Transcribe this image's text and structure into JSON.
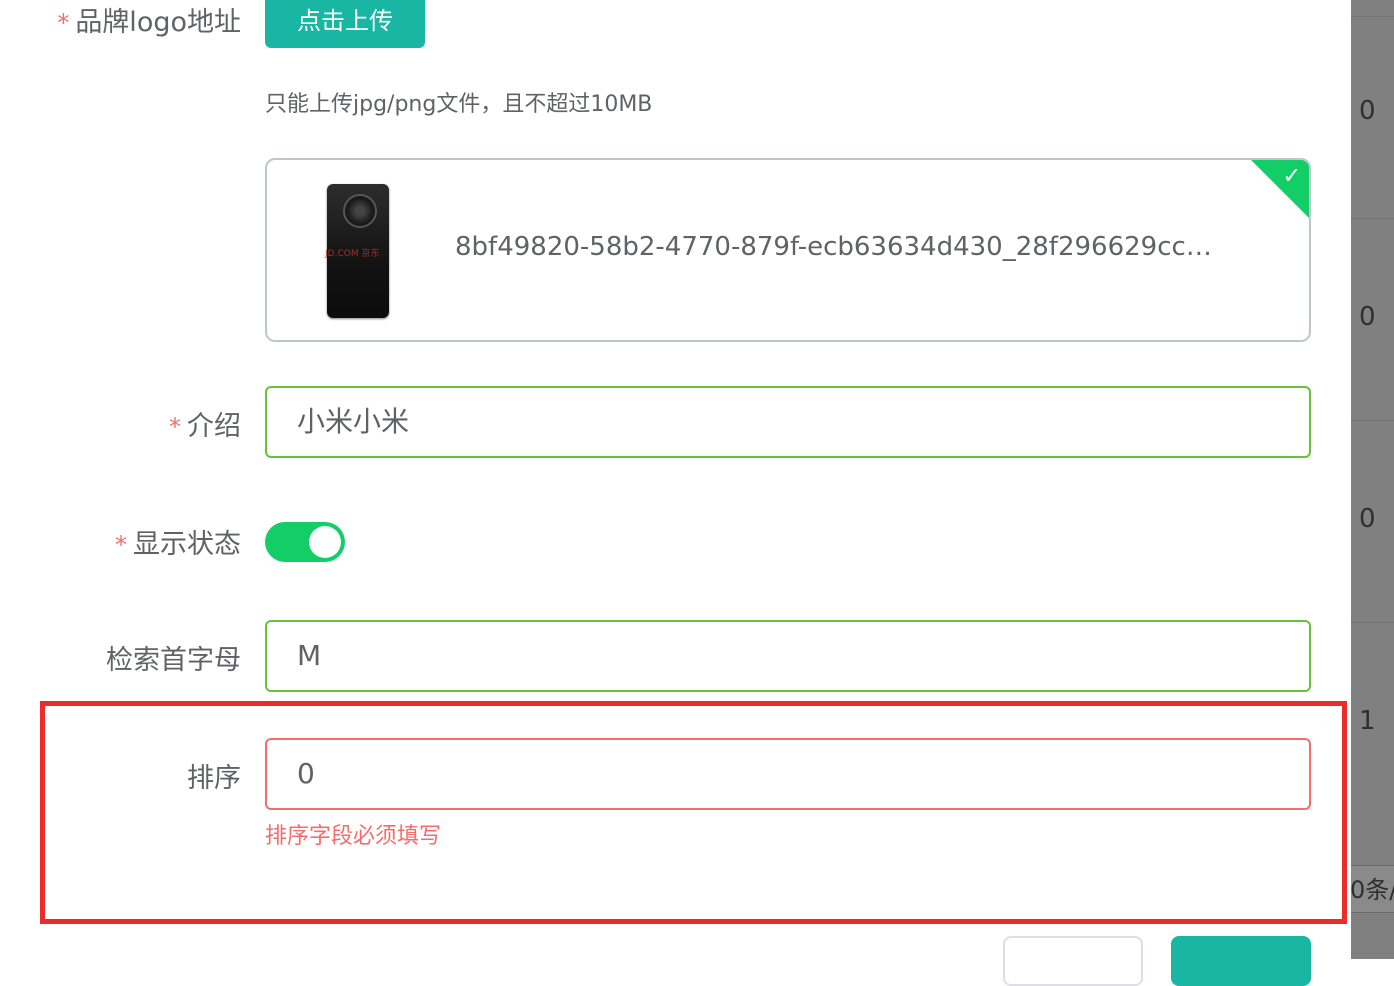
{
  "form": {
    "logo": {
      "label": "品牌logo地址",
      "upload_button": "点击上传",
      "tip": "只能上传jpg/png文件，且不超过10MB",
      "file_name": "8bf49820-58b2-4770-879f-ecb63634d430_28f296629cca8…",
      "status_icon": "check-icon"
    },
    "description": {
      "label": "介绍",
      "value": "小米小米"
    },
    "show_status": {
      "label": "显示状态",
      "value": true
    },
    "first_letter": {
      "label": "检索首字母",
      "value": "M"
    },
    "sort": {
      "label": "排序",
      "value": "0",
      "error": "排序字段必须填写"
    },
    "required_mark": "*"
  },
  "background_table": {
    "cells": [
      "0",
      "0",
      "0",
      "1"
    ],
    "pager_text": "0条/"
  },
  "colors": {
    "primary": "#1ab6a4",
    "success": "#13ce66",
    "error": "#f56c6c",
    "highlight": "#ee2b2b"
  }
}
